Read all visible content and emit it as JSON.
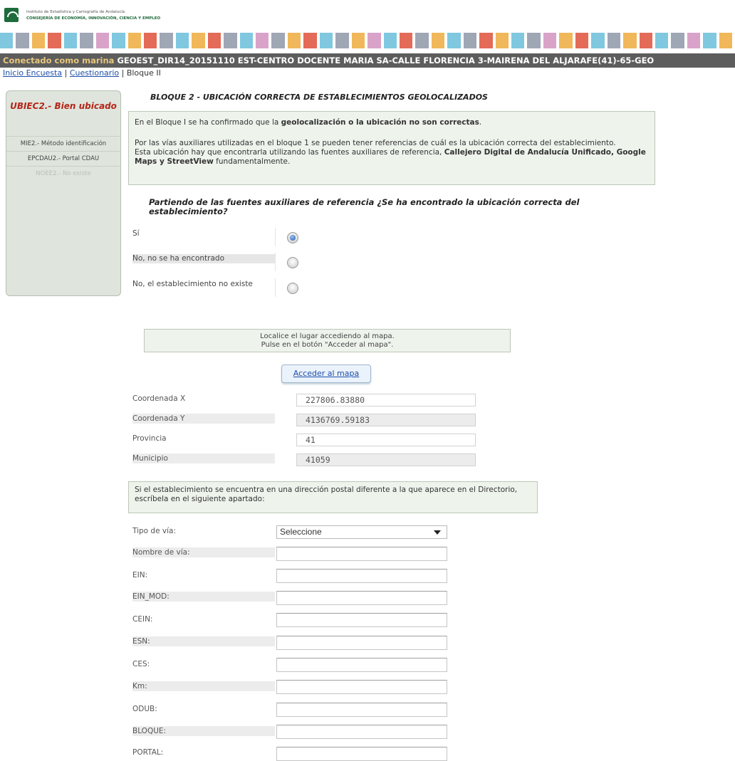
{
  "header": {
    "institute": "Instituto de Estadística y Cartografía de Andalucía",
    "ministry": "CONSEJERÍA DE ECONOMÍA, INNOVACIÓN, CIENCIA Y EMPLEO",
    "colorbar": [
      "#7fc8e0",
      "#9fa7b5",
      "#f0b85a",
      "#e36b57",
      "#7fc8e0",
      "#9fa7b5",
      "#d9a3c9",
      "#7fc8e0",
      "#f0b85a",
      "#e36b57",
      "#9fa7b5",
      "#7fc8e0",
      "#f0b85a",
      "#e36b57",
      "#9fa7b5",
      "#7fc8e0",
      "#d9a3c9",
      "#9fa7b5",
      "#f0b85a",
      "#e36b57",
      "#7fc8e0",
      "#9fa7b5",
      "#f0b85a",
      "#d9a3c9",
      "#7fc8e0",
      "#e36b57",
      "#9fa7b5",
      "#f0b85a",
      "#7fc8e0",
      "#9fa7b5",
      "#e36b57",
      "#f0b85a",
      "#7fc8e0",
      "#9fa7b5",
      "#d9a3c9",
      "#f0b85a",
      "#e36b57",
      "#7fc8e0",
      "#9fa7b5",
      "#f0b85a",
      "#e36b57",
      "#7fc8e0",
      "#9fa7b5",
      "#d9a3c9",
      "#7fc8e0",
      "#f0b85a"
    ]
  },
  "userbar": {
    "connected": "Conectado como marina",
    "session": "GEOEST_DIR14_20151110 EST-CENTRO DOCENTE MARIA SA-CALLE FLORENCIA 3-MAIRENA DEL ALJARAFE(41)-65-GEO"
  },
  "breadcrumb": {
    "home": "Inicio Encuesta",
    "sep1": "|",
    "questionnaire": "Cuestionario",
    "sep2": "|",
    "current": "Bloque II"
  },
  "sidebar": {
    "heading": "UBIEC2.- Bien ubicado",
    "items": [
      "MIE2.- Método identificación",
      "EPCDAU2.- Portal CDAU",
      "NOEE2.- No existe"
    ]
  },
  "main": {
    "title": "BLOQUE 2 - UBICACIÓN CORRECTA DE ESTABLECIMIENTOS GEOLOCALIZADOS",
    "info1_pre": "En el Bloque I se ha confirmado que la ",
    "info1_bold": "geolocalización o la ubicación no son correctas",
    "info1_post": ".",
    "info2_line1": "Por las vías auxiliares utilizadas en el bloque 1 se pueden tener referencias de cuál es la ubicación correcta del establecimiento.",
    "info2_pre": "Esta ubicación hay que encontrarla utilizando las fuentes auxiliares de referencia, ",
    "info2_bold": "Callejero Digital de Andalucía Unificado, Google Maps y StreetView",
    "info2_post": " fundamentalmente.",
    "question": "Partiendo de las fuentes auxiliares de referencia ¿Se ha encontrado la ubicación correcta del establecimiento?",
    "options": [
      "Sí",
      "No, no se ha encontrado",
      "No, el establecimiento no existe"
    ],
    "selected_option": "Sí",
    "map_hint1": "Localice el lugar accediendo al mapa.",
    "map_hint2": "Pulse en el botón \"Acceder al mapa\".",
    "map_button": "Acceder al mapa",
    "coords": {
      "x_label": "Coordenada X",
      "x_value": "227806.83880",
      "y_label": "Coordenada Y",
      "y_value": "4136769.59183",
      "prov_label": "Provincia",
      "prov_value": "41",
      "mun_label": "Municipio",
      "mun_value": "41059"
    },
    "address_note": "Si el establecimiento se encuentra en una dirección postal diferente a la que aparece en el Directorio, escríbela en el siguiente apartado:",
    "address_fields": {
      "tipo_label": "Tipo de vía:",
      "tipo_value": "Seleccione",
      "nombre_label": "Nombre de vía:",
      "ein_label": "EIN:",
      "einmod_label": "EIN_MOD:",
      "cein_label": "CEIN:",
      "esn_label": "ESN:",
      "ces_label": "CES:",
      "km_label": "Km:",
      "odub_label": "ODUB:",
      "bloque_label": "BLOQUE:",
      "portal_label": "PORTAL:"
    }
  }
}
